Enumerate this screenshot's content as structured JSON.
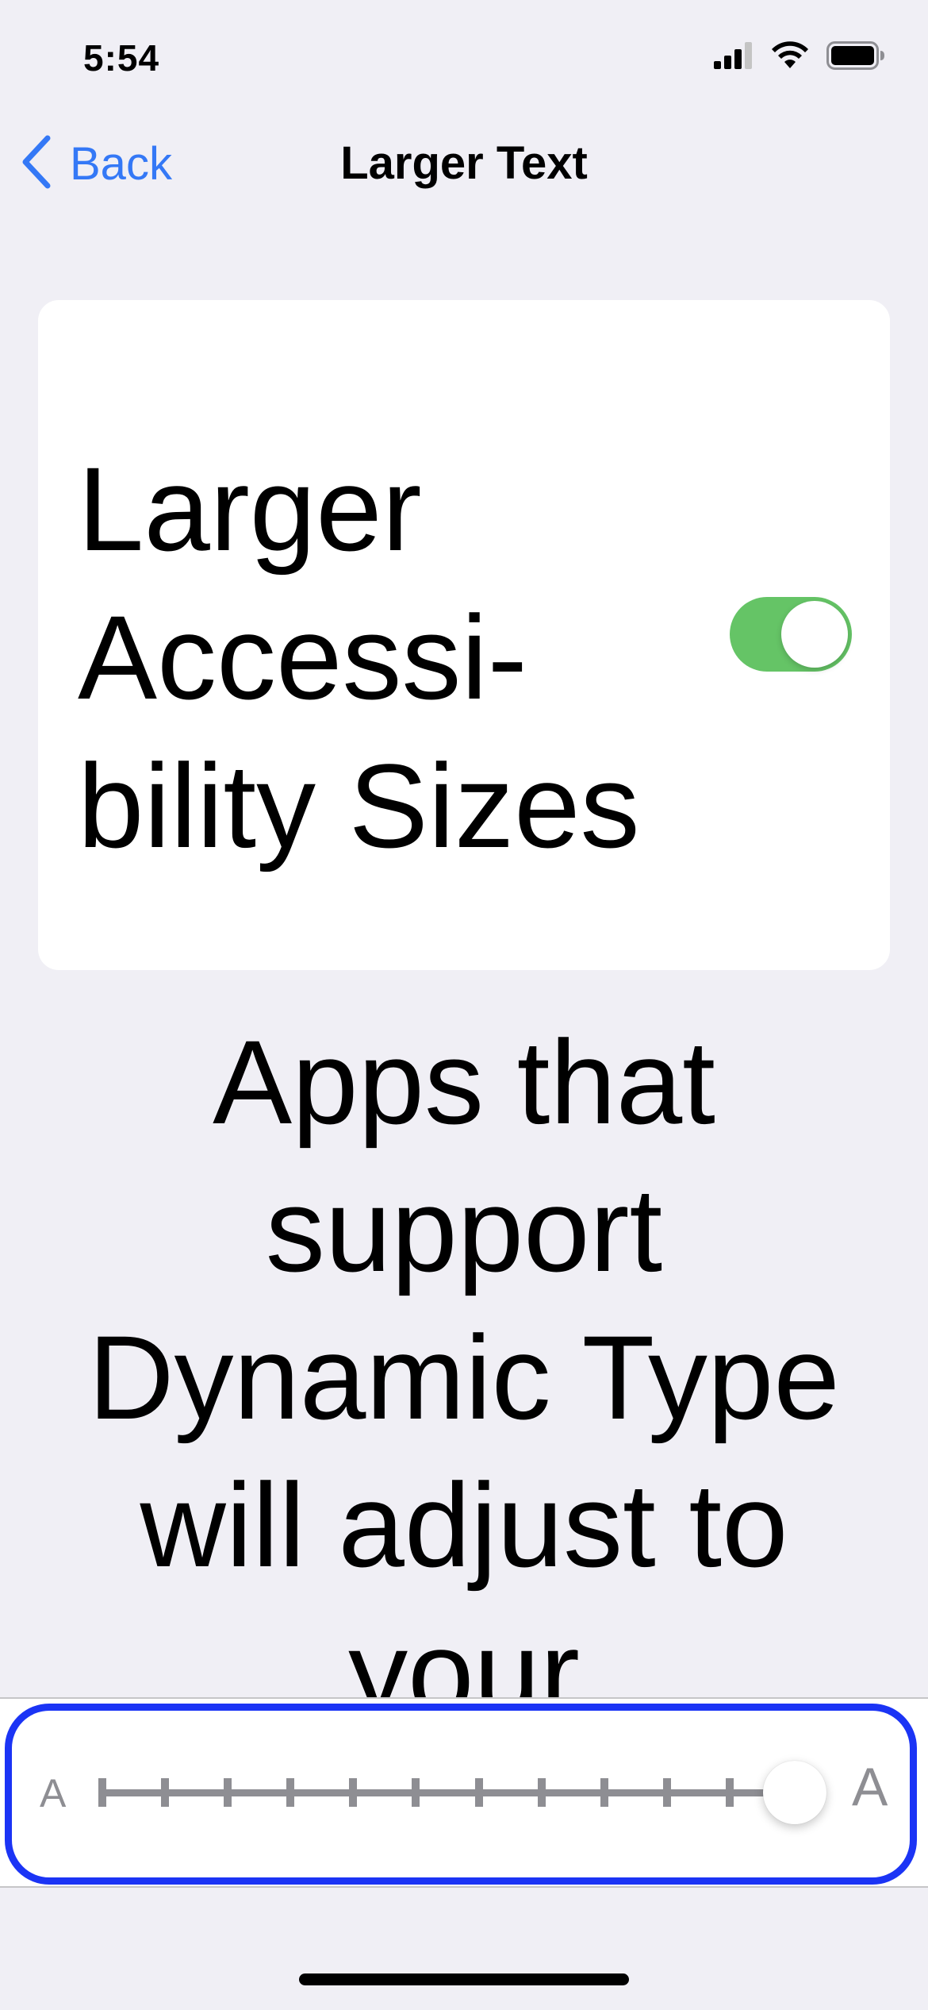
{
  "status_bar": {
    "time": "5:54",
    "icons": [
      "cellular-signal-icon",
      "wifi-icon",
      "battery-icon"
    ]
  },
  "nav": {
    "back_label": "Back",
    "back_icon": "chevron-left-icon",
    "title": "Larger Text"
  },
  "toggle": {
    "label": "Larger Accessi-bility Sizes",
    "state": "on",
    "on_color": "#65c466"
  },
  "description": "Apps that support Dynamic Type will adjust to your",
  "slider": {
    "min_label": "A",
    "max_label": "A",
    "steps": 12,
    "value_fraction": 1.0
  },
  "colors": {
    "accent": "#3478f6",
    "highlight_border": "#1b34f5",
    "background": "#f0eff5"
  }
}
